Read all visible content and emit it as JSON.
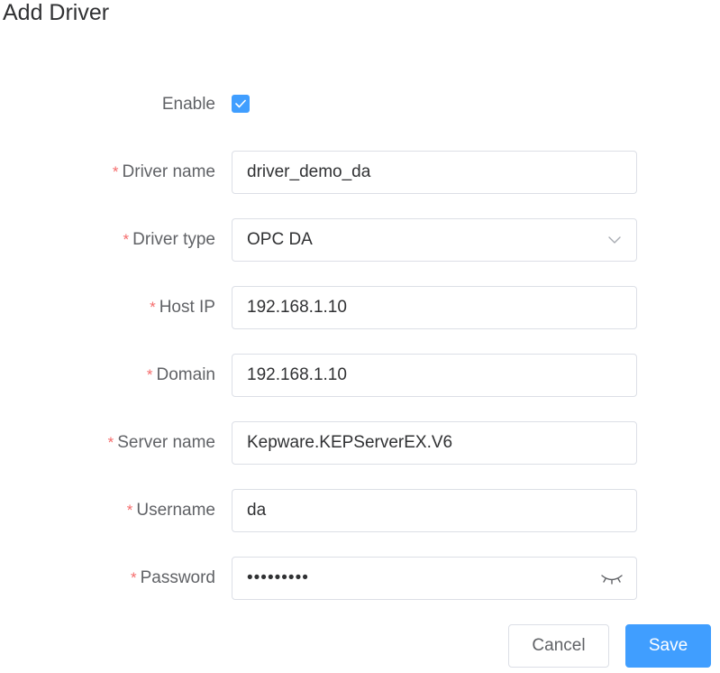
{
  "dialog": {
    "title": "Add Driver"
  },
  "form": {
    "enable": {
      "label": "Enable",
      "checked": true
    },
    "driver_name": {
      "required_mark": "*",
      "label": "Driver name",
      "value": "driver_demo_da"
    },
    "driver_type": {
      "required_mark": "*",
      "label": "Driver type",
      "selected": "OPC DA",
      "icon": "chevron-down-icon"
    },
    "host_ip": {
      "required_mark": "*",
      "label": "Host IP",
      "value": "192.168.1.10"
    },
    "domain": {
      "required_mark": "*",
      "label": "Domain",
      "value": "192.168.1.10"
    },
    "server_name": {
      "required_mark": "*",
      "label": "Server name",
      "value": "Kepware.KEPServerEX.V6"
    },
    "username": {
      "required_mark": "*",
      "label": "Username",
      "value": "da"
    },
    "password": {
      "required_mark": "*",
      "label": "Password",
      "value": "•••••••••",
      "icon": "eye-closed-icon"
    }
  },
  "actions": {
    "cancel_label": "Cancel",
    "save_label": "Save"
  },
  "colors": {
    "primary": "#409eff",
    "required": "#f56c6c",
    "border": "#dcdfe6",
    "label_text": "#606266",
    "value_text": "#303133"
  }
}
